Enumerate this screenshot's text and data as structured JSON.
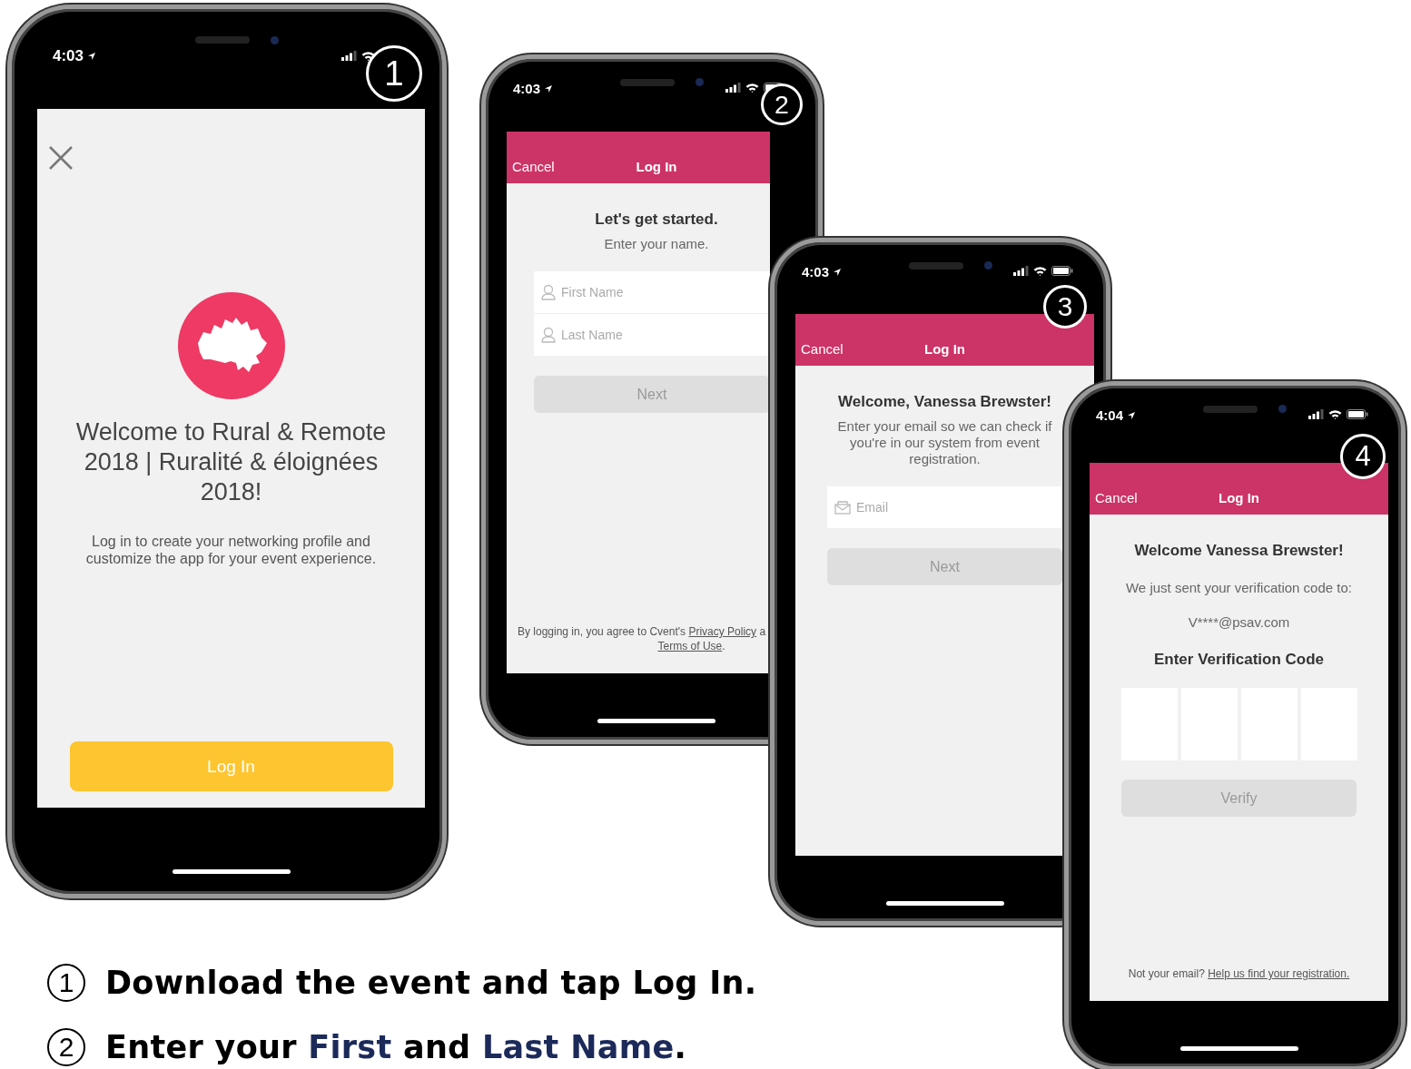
{
  "phones": [
    {
      "kind": "welcome",
      "time": "4:03",
      "step": "1",
      "welcome": {
        "title": "Welcome to Rural & Remote 2018 | Ruralité & éloignées 2018!",
        "description": "Log in to create your networking profile and customize the app for your event experience.",
        "button": "Log In"
      }
    },
    {
      "kind": "name",
      "time": "4:03",
      "step": "2",
      "nav": {
        "cancel": "Cancel",
        "title": "Log In"
      },
      "heading": "Let's get started.",
      "subheading": "Enter your name.",
      "fields": [
        {
          "placeholder": "First Name"
        },
        {
          "placeholder": "Last Name"
        }
      ],
      "button": "Next",
      "legal": {
        "prefix": "By logging in, you agree to Cvent's",
        "privacy_link": "Privacy Policy",
        "cut_word": "a",
        "terms_link": "Terms of Use",
        "end": "."
      }
    },
    {
      "kind": "email",
      "time": "4:03",
      "step": "3",
      "nav": {
        "cancel": "Cancel",
        "title": "Log In"
      },
      "heading": "Welcome, Vanessa Brewster!",
      "subheading": "Enter your email so we can check if you're in our system from event registration.",
      "fields": [
        {
          "placeholder": "Email"
        }
      ],
      "button": "Next"
    },
    {
      "kind": "code",
      "time": "4:04",
      "step": "4",
      "nav": {
        "cancel": "Cancel",
        "title": "Log In"
      },
      "heading": "Welcome Vanessa Brewster!",
      "subheading": "We just sent your verification code to:",
      "email": "V****@psav.com",
      "code_label": "Enter Verification Code",
      "button": "Verify",
      "footer": {
        "text": "Not your email?",
        "link": "Help us find your registration."
      }
    }
  ],
  "captions": [
    {
      "number": "1",
      "parts": [
        {
          "text": "Download the event and tap Log In.",
          "highlight": false
        }
      ]
    },
    {
      "number": "2",
      "parts": [
        {
          "text": "Enter your ",
          "highlight": false
        },
        {
          "text": "First",
          "highlight": true
        },
        {
          "text": " and ",
          "highlight": false
        },
        {
          "text": "Last Name",
          "highlight": true
        },
        {
          "text": ".",
          "highlight": false
        }
      ]
    }
  ]
}
